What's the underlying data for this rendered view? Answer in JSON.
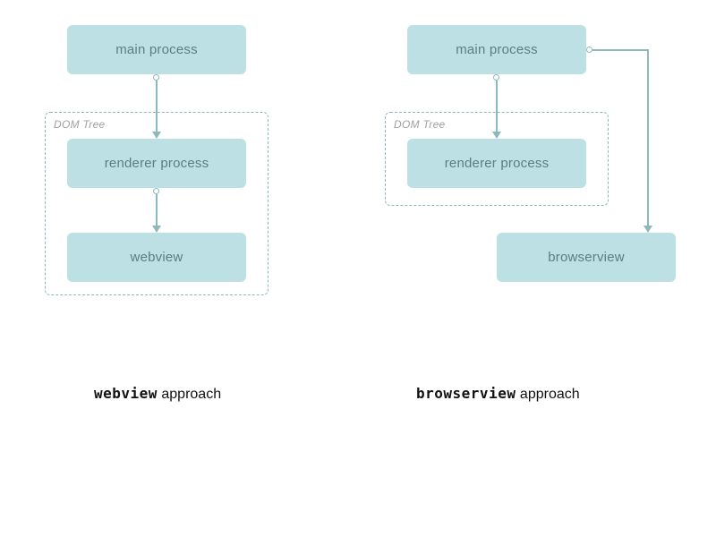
{
  "colors": {
    "box_fill": "#bce0e3",
    "box_text": "#5a7f82",
    "dash_border": "#8bb9bc",
    "dash_label": "#a0a0a0"
  },
  "left": {
    "box_main": "main process",
    "box_renderer": "renderer process",
    "box_webview": "webview",
    "dom_label": "DOM Tree",
    "caption_mono": "webview",
    "caption_rest": " approach"
  },
  "right": {
    "box_main": "main process",
    "box_renderer": "renderer process",
    "box_browserview": "browserview",
    "dom_label": "DOM Tree",
    "caption_mono": "browserview",
    "caption_rest": " approach"
  },
  "chart_data": {
    "type": "diagram",
    "title": "",
    "diagrams": [
      {
        "name": "webview approach",
        "dom_tree_container": [
          "renderer process",
          "webview"
        ],
        "nodes": [
          "main process",
          "renderer process",
          "webview"
        ],
        "edges": [
          {
            "from": "main process",
            "to": "renderer process"
          },
          {
            "from": "renderer process",
            "to": "webview"
          }
        ]
      },
      {
        "name": "browserview approach",
        "dom_tree_container": [
          "renderer process"
        ],
        "nodes": [
          "main process",
          "renderer process",
          "browserview"
        ],
        "edges": [
          {
            "from": "main process",
            "to": "renderer process"
          },
          {
            "from": "main process",
            "to": "browserview"
          }
        ]
      }
    ]
  }
}
